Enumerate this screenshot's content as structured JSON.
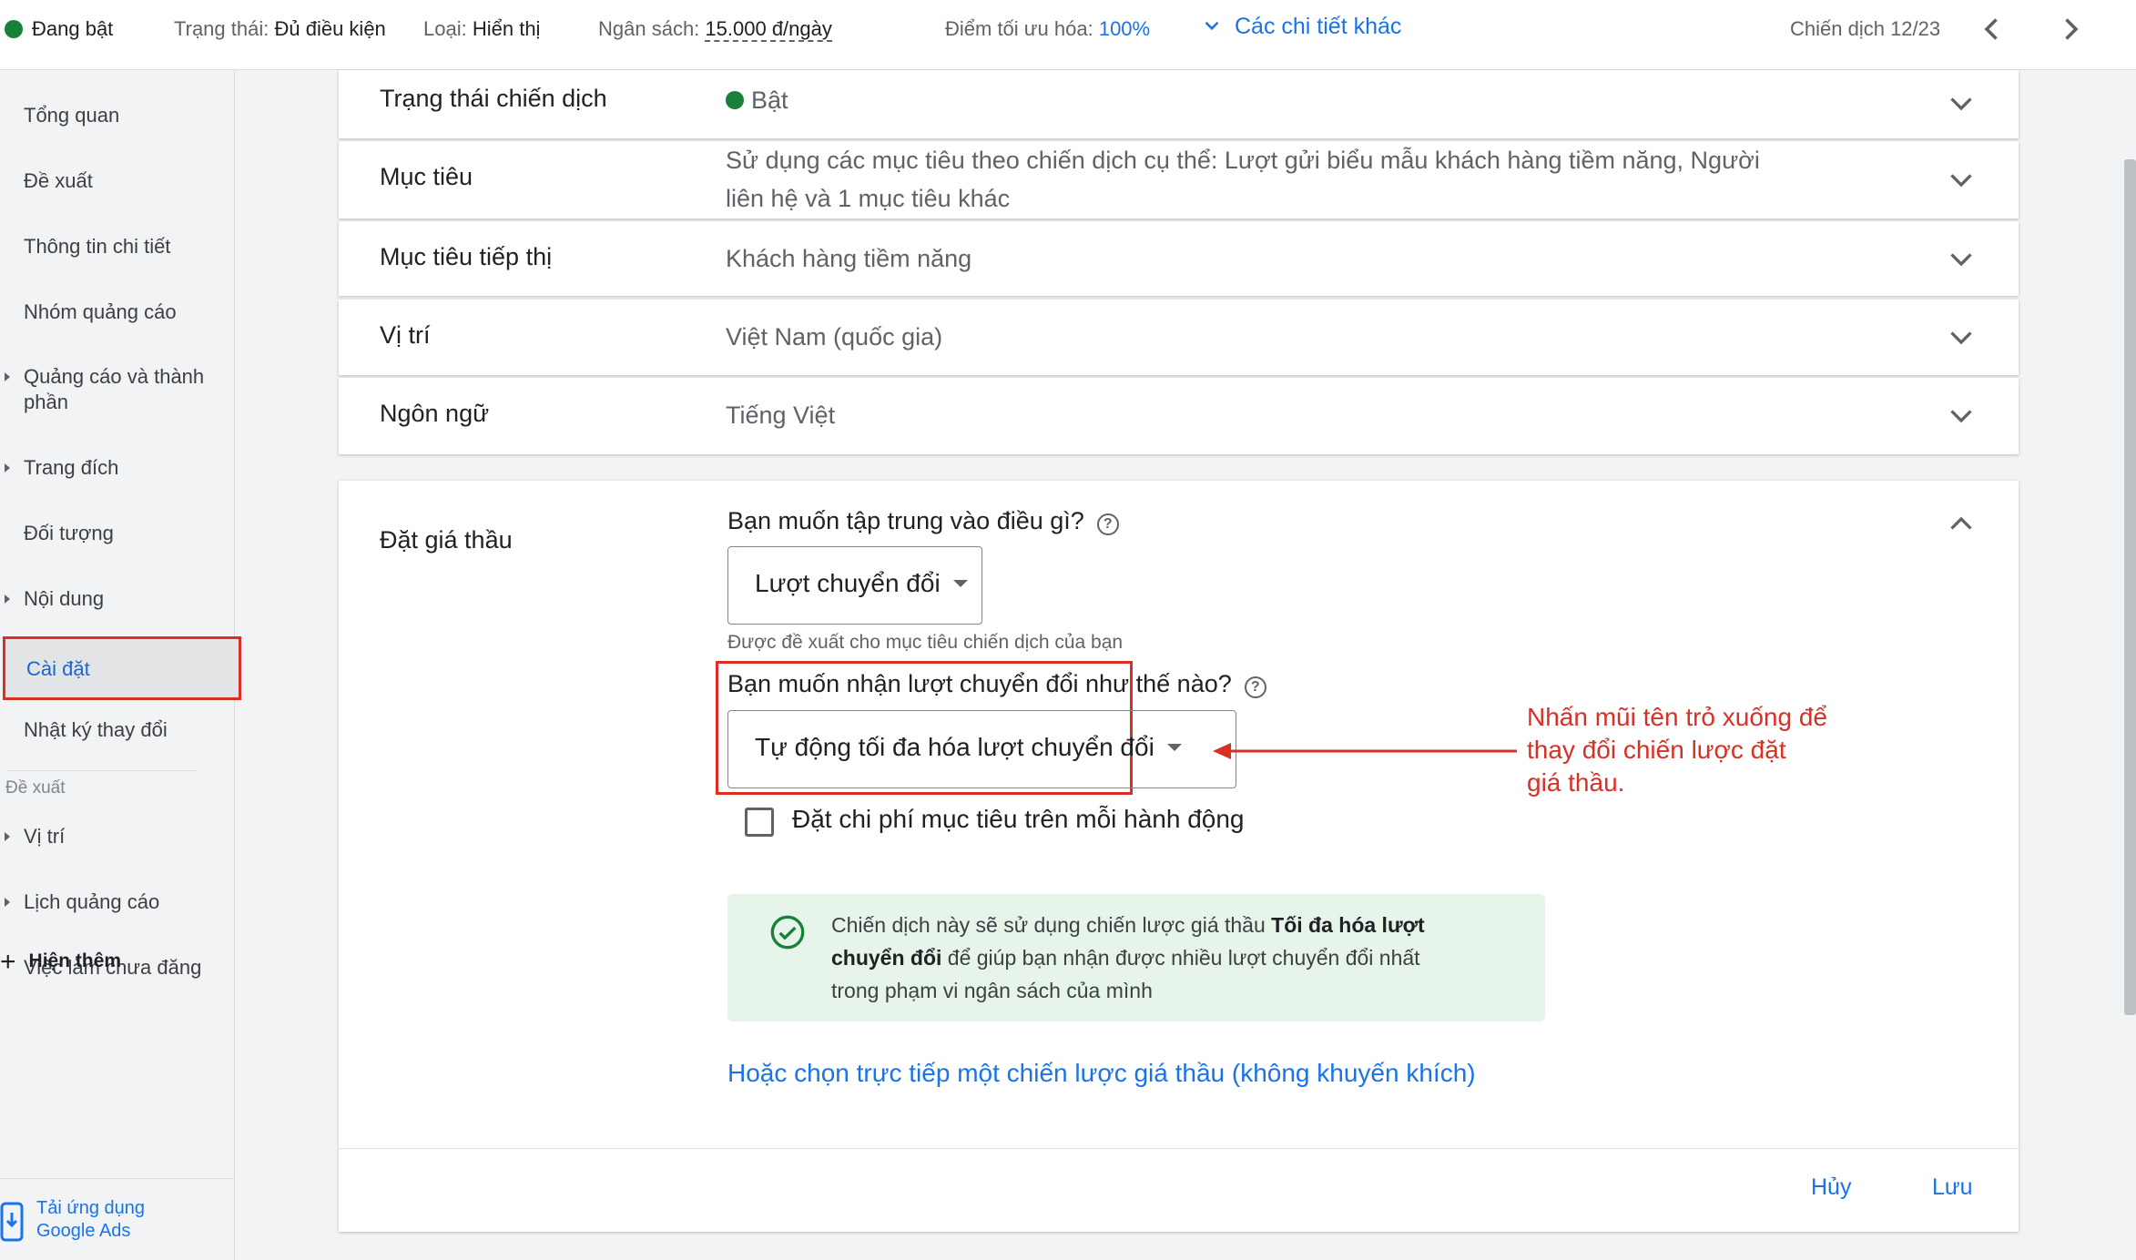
{
  "topbar": {
    "status": "Đang bật",
    "state_label": "Trạng thái:",
    "state_value": "Đủ điều kiện",
    "type_label": "Loại:",
    "type_value": "Hiển thị",
    "budget_label": "Ngân sách:",
    "budget_value": "15.000 đ/ngày",
    "score_label": "Điểm tối ưu hóa:",
    "score_value": "100%",
    "more_details": "Các chi tiết khác",
    "campaign_pager": "Chiến dịch 12/23"
  },
  "sidebar": {
    "items": [
      {
        "label": "Tổng quan"
      },
      {
        "label": "Đề xuất"
      },
      {
        "label": "Thông tin chi tiết"
      },
      {
        "label": "Nhóm quảng cáo"
      },
      {
        "label": "Quảng cáo và thành phần"
      },
      {
        "label": "Trang đích"
      },
      {
        "label": "Đối tượng"
      },
      {
        "label": "Nội dung"
      },
      {
        "label": "Cài đặt"
      },
      {
        "label": "Nhật ký thay đổi"
      }
    ],
    "section_label": "Đề xuất",
    "section_items": [
      {
        "label": "Vị trí"
      },
      {
        "label": "Lịch quảng cáo"
      },
      {
        "label": "Việc làm chưa đăng"
      }
    ],
    "show_more": "Hiện thêm",
    "app_link_line1": "Tải ứng dụng",
    "app_link_line2": "Google Ads"
  },
  "settings": {
    "status": {
      "label": "Trạng thái chiến dịch",
      "value": "Bật"
    },
    "goals": {
      "label": "Mục tiêu",
      "value_line1": "Sử dụng các mục tiêu theo chiến dịch cụ thể: Lượt gửi biểu mẫu khách hàng tiềm năng, Người",
      "value_line2": "liên hệ và 1 mục tiêu khác"
    },
    "marketing": {
      "label": "Mục tiêu tiếp thị",
      "value": "Khách hàng tiềm năng"
    },
    "location": {
      "label": "Vị trí",
      "value": "Việt Nam (quốc gia)"
    },
    "language": {
      "label": "Ngôn ngữ",
      "value": "Tiếng Việt"
    }
  },
  "bidding": {
    "label": "Đặt giá thầu",
    "question_focus": "Bạn muốn tập trung vào điều gì?",
    "focus_value": "Lượt chuyển đổi",
    "focus_hint": "Được đề xuất cho mục tiêu chiến dịch của bạn",
    "question_how": "Bạn muốn nhận lượt chuyển đổi như thế nào?",
    "how_value": "Tự động tối đa hóa lượt chuyển đổi",
    "target_cpa_label": "Đặt chi phí mục tiêu trên mỗi hành động",
    "info_pre": "Chiến dịch này sẽ sử dụng chiến lược giá thầu ",
    "info_bold1": "Tối đa hóa lượt",
    "info_bold2": "chuyển đổi",
    "info_post1": " để giúp bạn nhận được nhiều lượt chuyển đổi nhất",
    "info_post2": "trong phạm vi ngân sách của mình",
    "alt_link": "Hoặc chọn trực tiếp một chiến lược giá thầu (không khuyến khích)",
    "cancel": "Hủy",
    "save": "Lưu"
  },
  "annotation": {
    "line1": "Nhấn mũi tên trỏ xuống để",
    "line2": "thay đổi chiến lược đặt",
    "line3": "giá thầu."
  },
  "colors": {
    "accent": "#1a73e8",
    "status_green": "#188038",
    "annotation_red": "#d93025",
    "info_bg": "#e6f4ea"
  }
}
